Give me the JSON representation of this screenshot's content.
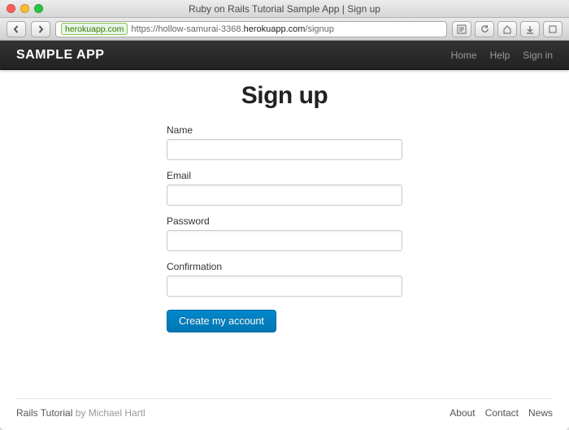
{
  "window": {
    "title": "Ruby on Rails Tutorial Sample App | Sign up"
  },
  "addressbar": {
    "site_badge": "herokuapp.com",
    "url_prefix": "https://hollow-samurai-3368.",
    "url_host": "herokuapp.com",
    "url_path": "/signup"
  },
  "navbar": {
    "brand": "SAMPLE APP",
    "links": {
      "home": "Home",
      "help": "Help",
      "signin": "Sign in"
    }
  },
  "page": {
    "heading": "Sign up",
    "fields": {
      "name_label": "Name",
      "email_label": "Email",
      "password_label": "Password",
      "confirmation_label": "Confirmation"
    },
    "submit_label": "Create my account"
  },
  "footer": {
    "left_link": "Rails Tutorial",
    "left_by": " by Michael Hartl",
    "links": {
      "about": "About",
      "contact": "Contact",
      "news": "News"
    }
  }
}
